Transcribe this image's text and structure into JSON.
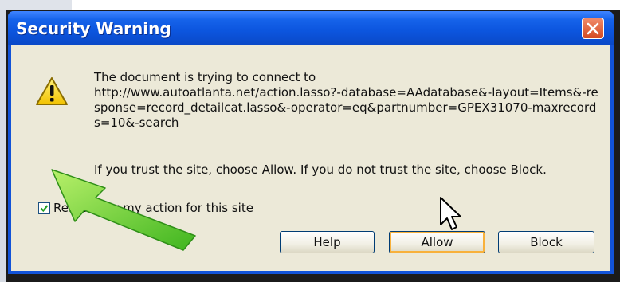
{
  "dialog": {
    "title": "Security Warning",
    "message_intro": "The document is trying to connect to",
    "url": "http://www.autoatlanta.net/action.lasso?-database=AAdatabase&-layout=Items&-response=record_detailcat.lasso&-operator=eq&partnumber=GPEX31070-maxrecords=10&-search",
    "trust_text": "If you trust the site, choose Allow. If you do not trust the site, choose Block.",
    "remember_label": "Remember my action for this site",
    "remember_checked": true,
    "buttons": {
      "help": "Help",
      "allow": "Allow",
      "block": "Block"
    },
    "icons": {
      "warning": "warning-icon",
      "close": "close-icon",
      "checkmark": "checkmark-icon",
      "cursor": "mouse-pointer-icon",
      "annotation": "green-arrow-icon"
    }
  },
  "colors": {
    "titlebar": "#0a49c8",
    "client_bg": "#ece9d8",
    "close_button": "#d44a22",
    "annotation_arrow": "#7ddc3a",
    "default_button_highlight": "#f8b13b"
  }
}
